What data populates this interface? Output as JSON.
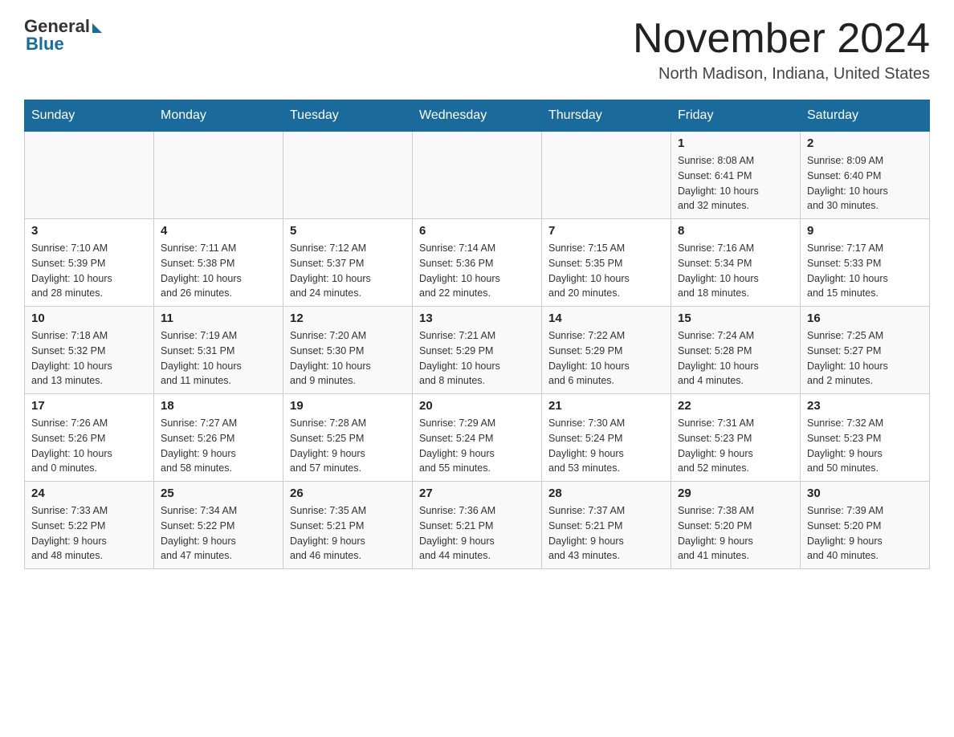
{
  "header": {
    "logo_general": "General",
    "logo_blue": "Blue",
    "month_title": "November 2024",
    "location": "North Madison, Indiana, United States"
  },
  "weekdays": [
    "Sunday",
    "Monday",
    "Tuesday",
    "Wednesday",
    "Thursday",
    "Friday",
    "Saturday"
  ],
  "weeks": [
    [
      {
        "day": "",
        "info": ""
      },
      {
        "day": "",
        "info": ""
      },
      {
        "day": "",
        "info": ""
      },
      {
        "day": "",
        "info": ""
      },
      {
        "day": "",
        "info": ""
      },
      {
        "day": "1",
        "info": "Sunrise: 8:08 AM\nSunset: 6:41 PM\nDaylight: 10 hours\nand 32 minutes."
      },
      {
        "day": "2",
        "info": "Sunrise: 8:09 AM\nSunset: 6:40 PM\nDaylight: 10 hours\nand 30 minutes."
      }
    ],
    [
      {
        "day": "3",
        "info": "Sunrise: 7:10 AM\nSunset: 5:39 PM\nDaylight: 10 hours\nand 28 minutes."
      },
      {
        "day": "4",
        "info": "Sunrise: 7:11 AM\nSunset: 5:38 PM\nDaylight: 10 hours\nand 26 minutes."
      },
      {
        "day": "5",
        "info": "Sunrise: 7:12 AM\nSunset: 5:37 PM\nDaylight: 10 hours\nand 24 minutes."
      },
      {
        "day": "6",
        "info": "Sunrise: 7:14 AM\nSunset: 5:36 PM\nDaylight: 10 hours\nand 22 minutes."
      },
      {
        "day": "7",
        "info": "Sunrise: 7:15 AM\nSunset: 5:35 PM\nDaylight: 10 hours\nand 20 minutes."
      },
      {
        "day": "8",
        "info": "Sunrise: 7:16 AM\nSunset: 5:34 PM\nDaylight: 10 hours\nand 18 minutes."
      },
      {
        "day": "9",
        "info": "Sunrise: 7:17 AM\nSunset: 5:33 PM\nDaylight: 10 hours\nand 15 minutes."
      }
    ],
    [
      {
        "day": "10",
        "info": "Sunrise: 7:18 AM\nSunset: 5:32 PM\nDaylight: 10 hours\nand 13 minutes."
      },
      {
        "day": "11",
        "info": "Sunrise: 7:19 AM\nSunset: 5:31 PM\nDaylight: 10 hours\nand 11 minutes."
      },
      {
        "day": "12",
        "info": "Sunrise: 7:20 AM\nSunset: 5:30 PM\nDaylight: 10 hours\nand 9 minutes."
      },
      {
        "day": "13",
        "info": "Sunrise: 7:21 AM\nSunset: 5:29 PM\nDaylight: 10 hours\nand 8 minutes."
      },
      {
        "day": "14",
        "info": "Sunrise: 7:22 AM\nSunset: 5:29 PM\nDaylight: 10 hours\nand 6 minutes."
      },
      {
        "day": "15",
        "info": "Sunrise: 7:24 AM\nSunset: 5:28 PM\nDaylight: 10 hours\nand 4 minutes."
      },
      {
        "day": "16",
        "info": "Sunrise: 7:25 AM\nSunset: 5:27 PM\nDaylight: 10 hours\nand 2 minutes."
      }
    ],
    [
      {
        "day": "17",
        "info": "Sunrise: 7:26 AM\nSunset: 5:26 PM\nDaylight: 10 hours\nand 0 minutes."
      },
      {
        "day": "18",
        "info": "Sunrise: 7:27 AM\nSunset: 5:26 PM\nDaylight: 9 hours\nand 58 minutes."
      },
      {
        "day": "19",
        "info": "Sunrise: 7:28 AM\nSunset: 5:25 PM\nDaylight: 9 hours\nand 57 minutes."
      },
      {
        "day": "20",
        "info": "Sunrise: 7:29 AM\nSunset: 5:24 PM\nDaylight: 9 hours\nand 55 minutes."
      },
      {
        "day": "21",
        "info": "Sunrise: 7:30 AM\nSunset: 5:24 PM\nDaylight: 9 hours\nand 53 minutes."
      },
      {
        "day": "22",
        "info": "Sunrise: 7:31 AM\nSunset: 5:23 PM\nDaylight: 9 hours\nand 52 minutes."
      },
      {
        "day": "23",
        "info": "Sunrise: 7:32 AM\nSunset: 5:23 PM\nDaylight: 9 hours\nand 50 minutes."
      }
    ],
    [
      {
        "day": "24",
        "info": "Sunrise: 7:33 AM\nSunset: 5:22 PM\nDaylight: 9 hours\nand 48 minutes."
      },
      {
        "day": "25",
        "info": "Sunrise: 7:34 AM\nSunset: 5:22 PM\nDaylight: 9 hours\nand 47 minutes."
      },
      {
        "day": "26",
        "info": "Sunrise: 7:35 AM\nSunset: 5:21 PM\nDaylight: 9 hours\nand 46 minutes."
      },
      {
        "day": "27",
        "info": "Sunrise: 7:36 AM\nSunset: 5:21 PM\nDaylight: 9 hours\nand 44 minutes."
      },
      {
        "day": "28",
        "info": "Sunrise: 7:37 AM\nSunset: 5:21 PM\nDaylight: 9 hours\nand 43 minutes."
      },
      {
        "day": "29",
        "info": "Sunrise: 7:38 AM\nSunset: 5:20 PM\nDaylight: 9 hours\nand 41 minutes."
      },
      {
        "day": "30",
        "info": "Sunrise: 7:39 AM\nSunset: 5:20 PM\nDaylight: 9 hours\nand 40 minutes."
      }
    ]
  ]
}
